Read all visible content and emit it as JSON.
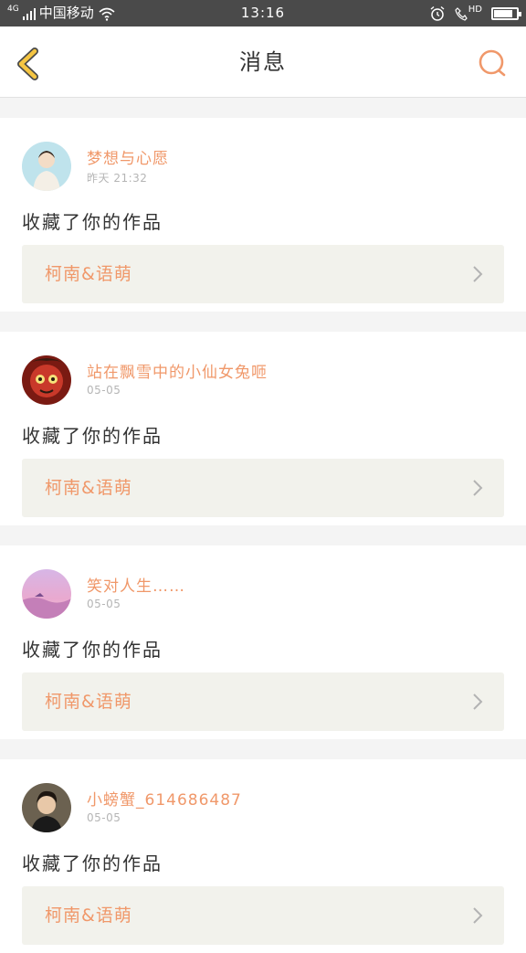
{
  "status_bar": {
    "network_type": "4G",
    "carrier": "中国移动",
    "time": "13:16",
    "hd_label": "HD",
    "signal_level": 4,
    "battery_level": 0.85
  },
  "header": {
    "title": "消息",
    "back_icon": "chevron-left-icon",
    "search_icon": "search-icon"
  },
  "colors": {
    "accent": "#f0986a",
    "back_yellow": "#f5c542",
    "text_dark": "#333333",
    "text_muted": "#b5b5b5",
    "work_box_bg": "#f2f2ec"
  },
  "messages": [
    {
      "username": "梦想与心愿",
      "time": "昨天 21:32",
      "action": "收藏了你的作品",
      "work_title": "柯南&语萌"
    },
    {
      "username": "站在飘雪中的小仙女兔咂",
      "time": "05-05",
      "action": "收藏了你的作品",
      "work_title": "柯南&语萌"
    },
    {
      "username": "笑对人生……",
      "time": "05-05",
      "action": "收藏了你的作品",
      "work_title": "柯南&语萌"
    },
    {
      "username": "小螃蟹_614686487",
      "time": "05-05",
      "action": "收藏了你的作品",
      "work_title": "柯南&语萌"
    }
  ]
}
